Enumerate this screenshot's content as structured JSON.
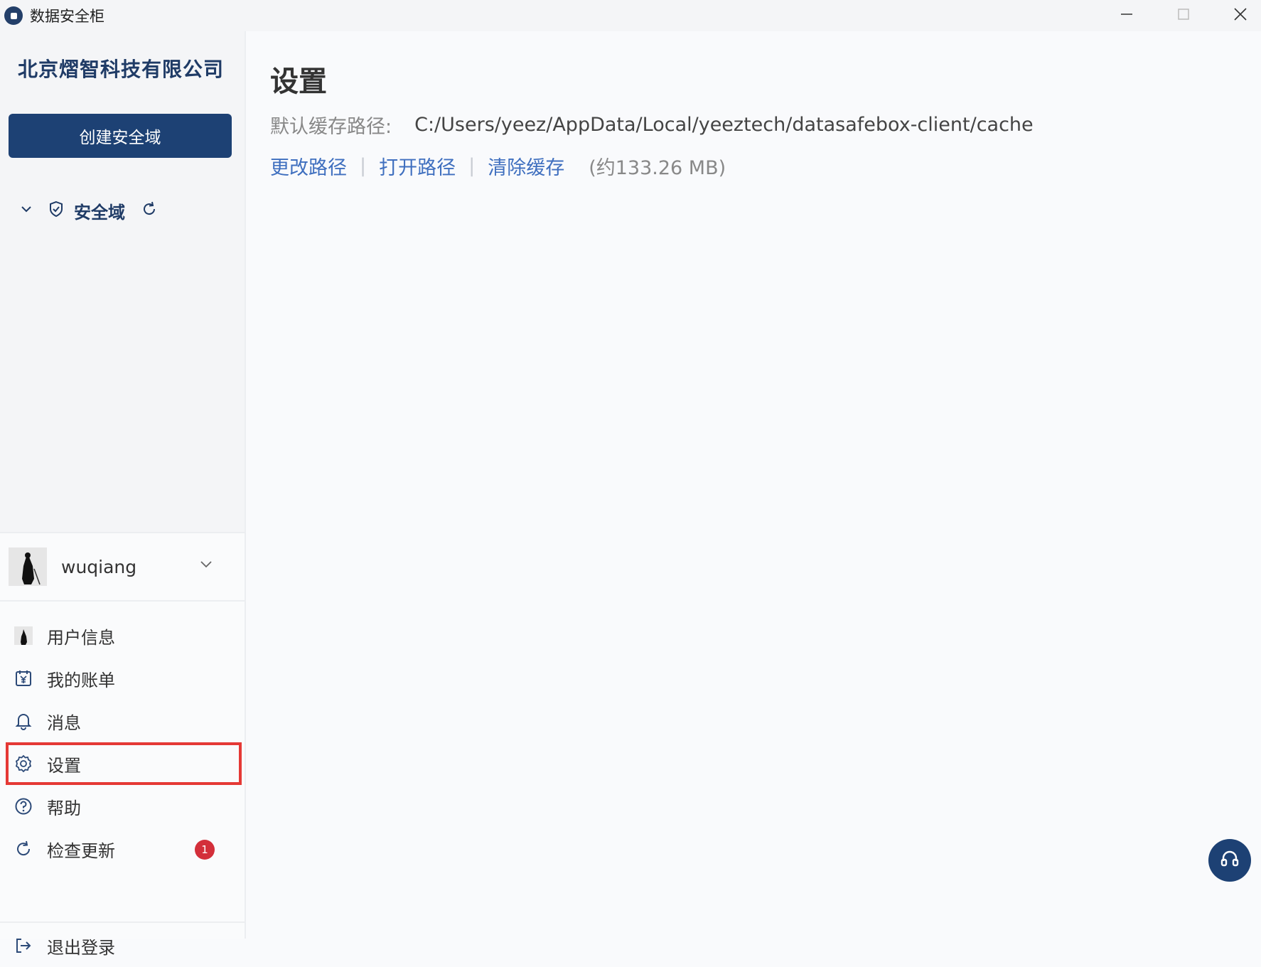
{
  "window": {
    "title": "数据安全柜",
    "icon": "app-icon",
    "controls": [
      "minimize-icon",
      "maximize-icon",
      "close-icon"
    ]
  },
  "sidebar": {
    "company_name": "北京熠智科技有限公司",
    "create_button_label": "创建安全域",
    "tree": {
      "expanded": true,
      "label": "安全域",
      "icon": "shield-icon",
      "refresh_icon": "refresh-icon"
    },
    "user": {
      "name": "wuqiang",
      "avatar": "avatar-image"
    },
    "menu": [
      {
        "label": "用户信息",
        "icon": "user-avatar-icon"
      },
      {
        "label": "我的账单",
        "icon": "bill-icon"
      },
      {
        "label": "消息",
        "icon": "bell-icon"
      },
      {
        "label": "设置",
        "icon": "gear-icon",
        "highlighted": true
      },
      {
        "label": "帮助",
        "icon": "help-circle-icon"
      },
      {
        "label": "检查更新",
        "icon": "refresh-icon",
        "badge": "1"
      },
      {
        "label": "退出登录",
        "icon": "logout-icon"
      }
    ]
  },
  "main": {
    "title": "设置",
    "cache_label": "默认缓存路径:",
    "cache_path": "C:/Users/yeez/AppData/Local/yeeztech/datasafebox-client/cache",
    "actions": {
      "change_path": "更改路径",
      "open_path": "打开路径",
      "clear_cache": "清除缓存",
      "separator": "|",
      "size_note": "(约133.26 MB)"
    }
  },
  "support_button": {
    "icon": "headset-icon"
  },
  "colors": {
    "brand": "#1d4174",
    "link": "#3f6fbf",
    "badge": "#d32f3a",
    "highlight_outline": "#e53935"
  }
}
